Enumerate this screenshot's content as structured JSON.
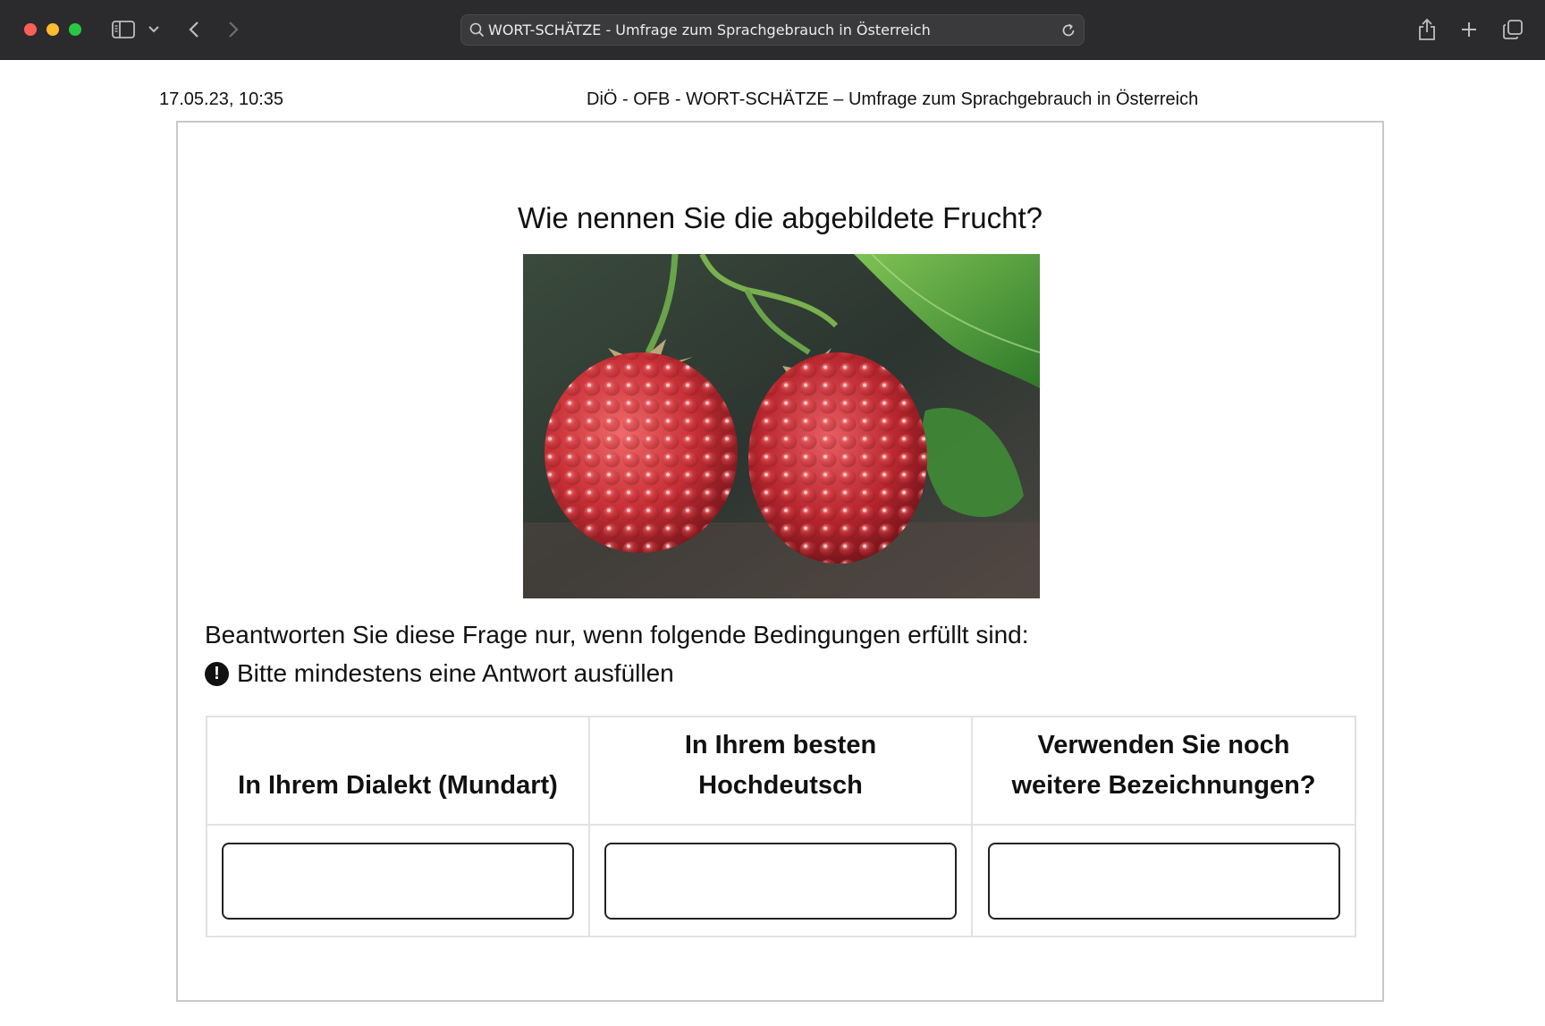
{
  "browser": {
    "url_text": "WORT-SCHÄTZE - Umfrage zum Sprachgebrauch in Österreich"
  },
  "print_header": {
    "date": "17.05.23, 10:35",
    "title": "DiÖ - OFB - WORT-SCHÄTZE – Umfrage zum Sprachgebrauch in Österreich"
  },
  "survey": {
    "question": "Wie nennen Sie die abgebildete Frucht?",
    "condition": "Beantworten Sie diese Frage nur, wenn folgende Bedingungen erfüllt sind:",
    "requirement": "Bitte mindestens eine Antwort ausfüllen",
    "columns": [
      {
        "line1": "",
        "line2": "In Ihrem Dialekt (Mundart)",
        "value": ""
      },
      {
        "line1": "In Ihrem besten",
        "line2": "Hochdeutsch",
        "value": ""
      },
      {
        "line1": "Verwenden Sie noch",
        "line2": "weitere Bezeichnungen?",
        "value": ""
      }
    ]
  },
  "icons": {
    "search": "search-icon",
    "reload": "reload-icon",
    "warning": "exclamation-circle-icon"
  }
}
